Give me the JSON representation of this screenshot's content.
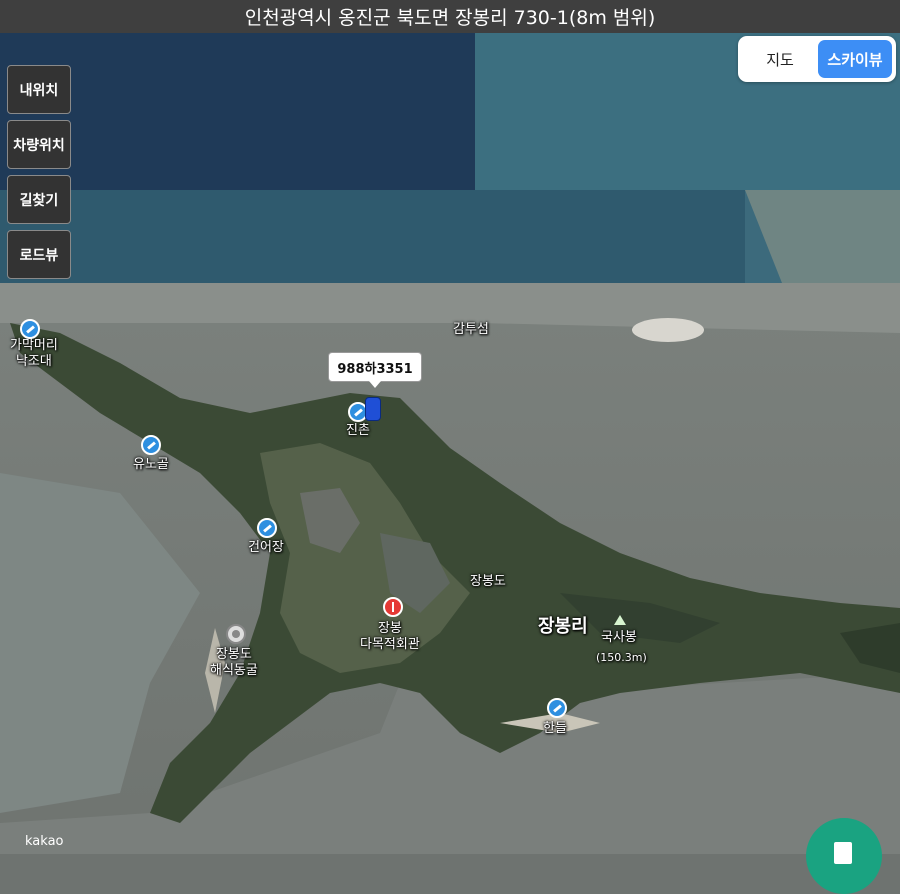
{
  "header": {
    "title": "인천광역시 옹진군 북도면 장봉리 730-1(8m 범위)"
  },
  "left_buttons": [
    {
      "label": "내위치"
    },
    {
      "label": "차량위치"
    },
    {
      "label": "길찾기"
    },
    {
      "label": "로드뷰"
    }
  ],
  "view_toggle": {
    "map_label": "지도",
    "skyview_label": "스카이뷰",
    "selected": "스카이뷰"
  },
  "vehicle": {
    "plate": "988하3351"
  },
  "places": {
    "gamakmeori": "가막머리\n낙조대",
    "yunogol": "유노골",
    "jinchon": "진촌",
    "gamtuseom": "감투섬",
    "geoneojang": "건어장",
    "jangbongdo_island": "장봉도",
    "jangbong_hall": "장봉\n다목적회관",
    "jangbongri": "장봉리",
    "guksabong": "국사봉",
    "guksabong_height": "(150.3m)",
    "jangbongdo_cave": "장봉도\n해식동굴",
    "handeul": "한들"
  },
  "colors": {
    "accent": "#3d8ef5",
    "fab": "#1aa381",
    "pin": "#2e8fe0",
    "red_poi": "#e53935"
  },
  "attribution": "kakao"
}
